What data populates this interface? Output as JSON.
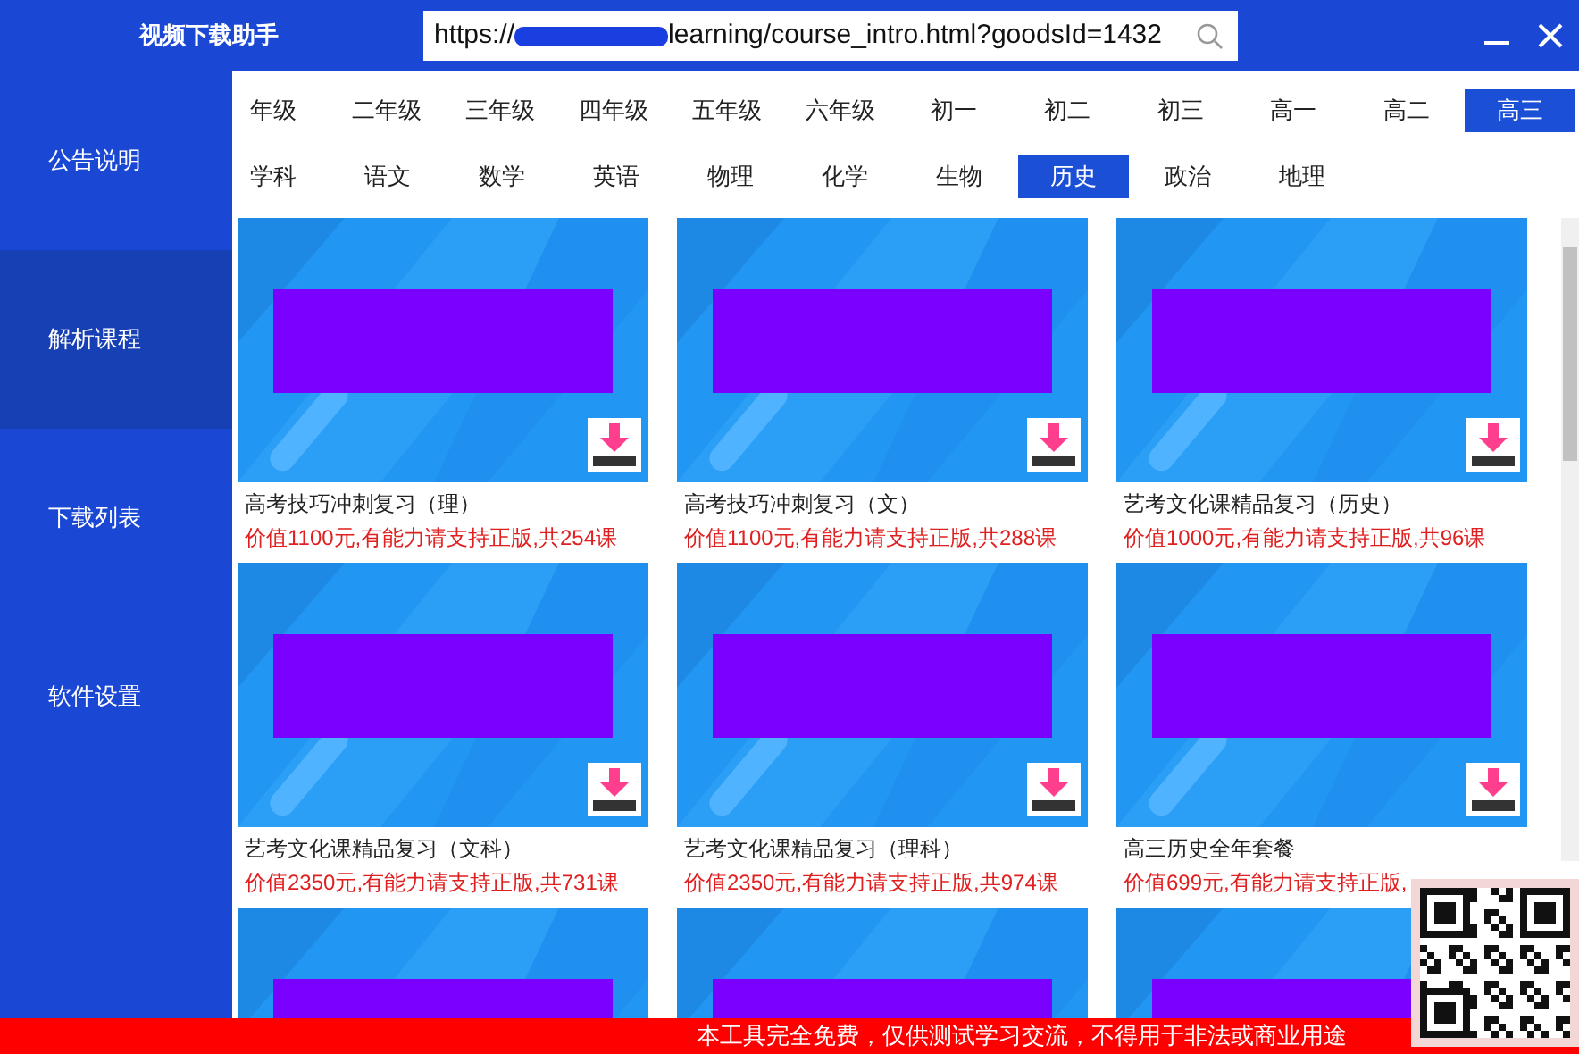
{
  "app_title": "视频下载助手",
  "url": {
    "prefix": "https://",
    "value": "learning/course_intro.html?goodsId=1432"
  },
  "sidebar": [
    {
      "label": "公告说明",
      "selected": false
    },
    {
      "label": "解析课程",
      "selected": true
    },
    {
      "label": "下载列表",
      "selected": false
    },
    {
      "label": "软件设置",
      "selected": false
    }
  ],
  "grade_filter": {
    "label": "年级",
    "options": [
      {
        "label": "二年级",
        "selected": false
      },
      {
        "label": "三年级",
        "selected": false
      },
      {
        "label": "四年级",
        "selected": false
      },
      {
        "label": "五年级",
        "selected": false
      },
      {
        "label": "六年级",
        "selected": false
      },
      {
        "label": "初一",
        "selected": false
      },
      {
        "label": "初二",
        "selected": false
      },
      {
        "label": "初三",
        "selected": false
      },
      {
        "label": "高一",
        "selected": false
      },
      {
        "label": "高二",
        "selected": false
      },
      {
        "label": "高三",
        "selected": true
      }
    ]
  },
  "subject_filter": {
    "label": "学科",
    "options": [
      {
        "label": "语文",
        "selected": false
      },
      {
        "label": "数学",
        "selected": false
      },
      {
        "label": "英语",
        "selected": false
      },
      {
        "label": "物理",
        "selected": false
      },
      {
        "label": "化学",
        "selected": false
      },
      {
        "label": "生物",
        "selected": false
      },
      {
        "label": "历史",
        "selected": true
      },
      {
        "label": "政治",
        "selected": false
      },
      {
        "label": "地理",
        "selected": false
      }
    ]
  },
  "courses": [
    {
      "kind": "course",
      "title": "高考技巧冲刺复习（理）",
      "price": "价值1100元,有能力请支持正版,共254课"
    },
    {
      "kind": "course",
      "title": "高考技巧冲刺复习（文）",
      "price": "价值1100元,有能力请支持正版,共288课"
    },
    {
      "kind": "course",
      "title": "艺考文化课精品复习（历史）",
      "price": "价值1000元,有能力请支持正版,共96课"
    },
    {
      "kind": "course",
      "title": "艺考文化课精品复习（文科）",
      "price": "价值2350元,有能力请支持正版,共731课"
    },
    {
      "kind": "course",
      "title": "艺考文化课精品复习（理科）",
      "price": "价值2350元,有能力请支持正版,共974课"
    },
    {
      "kind": "course",
      "title": "高三历史全年套餐",
      "price": "价值699元,有能力请支持正版,"
    },
    {
      "kind": "picture"
    },
    {
      "kind": "picture"
    },
    {
      "kind": "picture"
    }
  ],
  "footer": "本工具完全免费，仅供测试学习交流，不得用于非法或商业用途"
}
